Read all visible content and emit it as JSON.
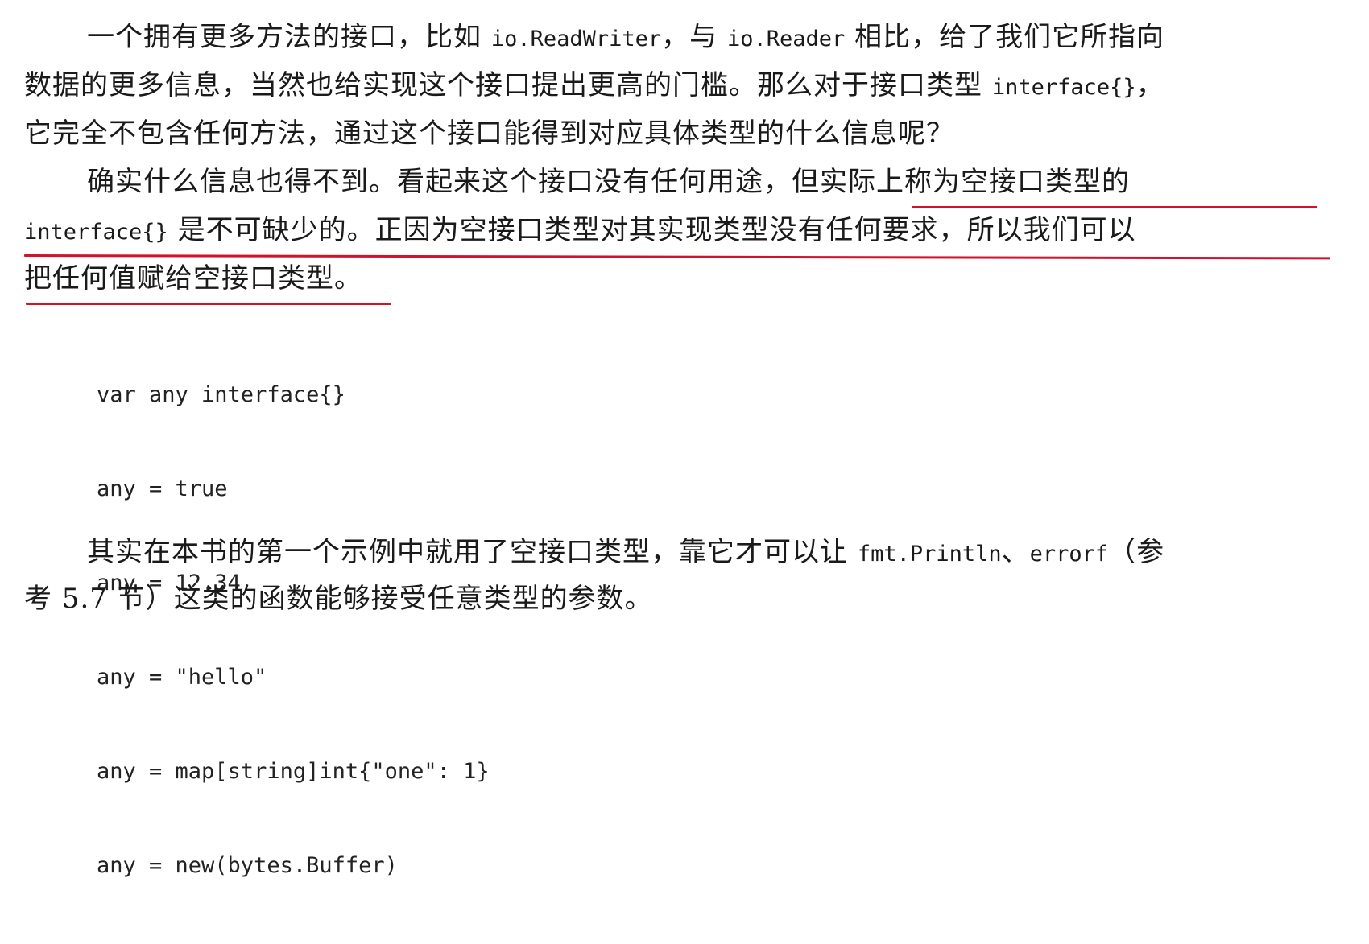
{
  "paragraphs": [
    {
      "lines": [
        [
          "一个拥有更多方法的接口，比如 ",
          "io.ReadWriter",
          "，与 ",
          "io.Reader",
          " 相比，给了我们它所指向"
        ],
        [
          "数据的更多信息，当然也给实现这个接口提出更高的门槛。那么对于接口类型 ",
          "interface{}",
          "，"
        ],
        [
          "它完全不包含任何方法，通过这个接口能得到对应具体类型的什么信息呢？"
        ]
      ]
    },
    {
      "lines": [
        [
          "确实什么信息也得不到。看起来这个接口没有任何用途，",
          "但实际上称为空接口类型的"
        ],
        [
          "interface{}",
          " 是不可缺少的。正因为空接口类型对其实现类型没有任何要求，所以我们可以"
        ],
        [
          "把任何值赋给空接口类型。"
        ]
      ]
    }
  ],
  "code_block": [
    "var any interface{}",
    "any = true",
    "any = 12.34",
    "any = \"hello\"",
    "any = map[string]int{\"one\": 1}",
    "any = new(bytes.Buffer)"
  ],
  "closing_paragraph": {
    "lines": [
      [
        "其实在本书的第一个示例中就用了空接口类型，靠它才可以让 ",
        "fmt.Println",
        "、",
        "errorf",
        "（参"
      ],
      [
        "考 5.7 节）这类的函数能够接受任意类型的参数。"
      ]
    ]
  },
  "highlight_color": "#d0122a"
}
